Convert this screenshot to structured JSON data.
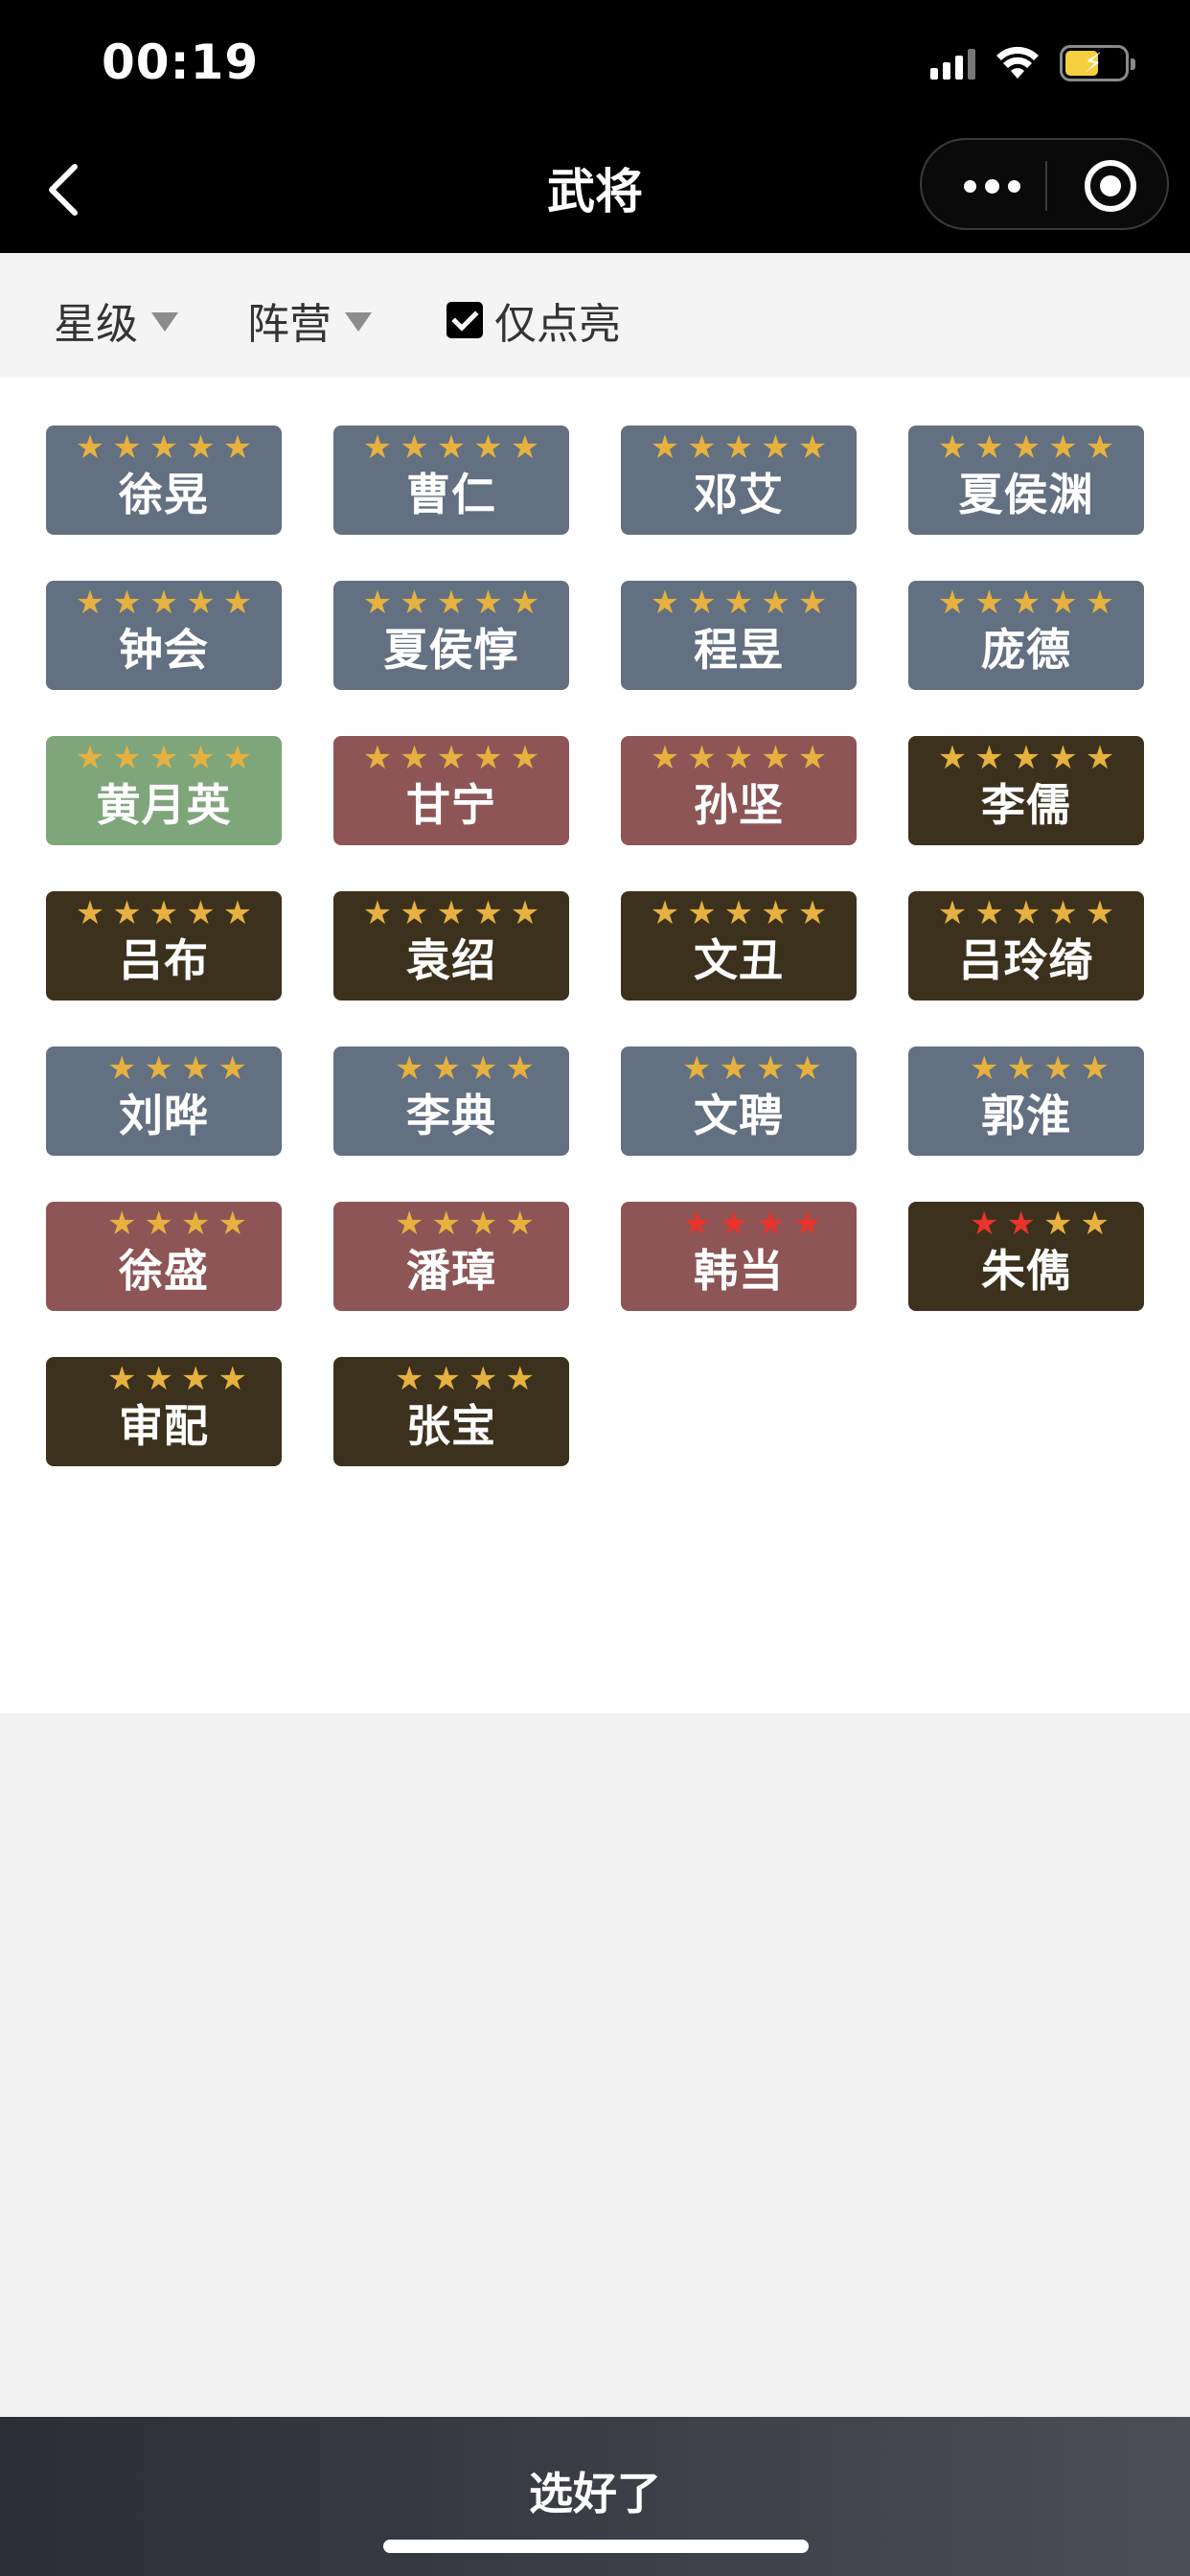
{
  "status_bar": {
    "time": "00:19"
  },
  "nav": {
    "title": "武将"
  },
  "filters": {
    "star_label": "星级",
    "faction_label": "阵营",
    "lit_only_label": "仅点亮",
    "lit_only_checked": true
  },
  "colors": {
    "blue": "#627081",
    "green": "#7fa57b",
    "red": "#8d5556",
    "dark": "#3c311d",
    "star_gold": "#e6b13f",
    "star_red": "#e8342c"
  },
  "generals": [
    {
      "name": "徐晃",
      "stars": 5,
      "red_stars": 0,
      "faction": "blue"
    },
    {
      "name": "曹仁",
      "stars": 5,
      "red_stars": 0,
      "faction": "blue"
    },
    {
      "name": "邓艾",
      "stars": 5,
      "red_stars": 0,
      "faction": "blue"
    },
    {
      "name": "夏侯渊",
      "stars": 5,
      "red_stars": 0,
      "faction": "blue"
    },
    {
      "name": "钟会",
      "stars": 5,
      "red_stars": 0,
      "faction": "blue"
    },
    {
      "name": "夏侯惇",
      "stars": 5,
      "red_stars": 0,
      "faction": "blue"
    },
    {
      "name": "程昱",
      "stars": 5,
      "red_stars": 0,
      "faction": "blue"
    },
    {
      "name": "庞德",
      "stars": 5,
      "red_stars": 0,
      "faction": "blue"
    },
    {
      "name": "黄月英",
      "stars": 5,
      "red_stars": 0,
      "faction": "green"
    },
    {
      "name": "甘宁",
      "stars": 5,
      "red_stars": 0,
      "faction": "red"
    },
    {
      "name": "孙坚",
      "stars": 5,
      "red_stars": 0,
      "faction": "red"
    },
    {
      "name": "李儒",
      "stars": 5,
      "red_stars": 0,
      "faction": "dark"
    },
    {
      "name": "吕布",
      "stars": 5,
      "red_stars": 0,
      "faction": "dark"
    },
    {
      "name": "袁绍",
      "stars": 5,
      "red_stars": 0,
      "faction": "dark"
    },
    {
      "name": "文丑",
      "stars": 5,
      "red_stars": 0,
      "faction": "dark"
    },
    {
      "name": "吕玲绮",
      "stars": 5,
      "red_stars": 0,
      "faction": "dark"
    },
    {
      "name": "刘晔",
      "stars": 4,
      "red_stars": 0,
      "faction": "blue"
    },
    {
      "name": "李典",
      "stars": 4,
      "red_stars": 0,
      "faction": "blue"
    },
    {
      "name": "文聘",
      "stars": 4,
      "red_stars": 0,
      "faction": "blue"
    },
    {
      "name": "郭淮",
      "stars": 4,
      "red_stars": 0,
      "faction": "blue"
    },
    {
      "name": "徐盛",
      "stars": 4,
      "red_stars": 0,
      "faction": "red"
    },
    {
      "name": "潘璋",
      "stars": 4,
      "red_stars": 0,
      "faction": "red"
    },
    {
      "name": "韩当",
      "stars": 4,
      "red_stars": 4,
      "faction": "red"
    },
    {
      "name": "朱儁",
      "stars": 4,
      "red_stars": 2,
      "faction": "dark"
    },
    {
      "name": "审配",
      "stars": 4,
      "red_stars": 0,
      "faction": "dark"
    },
    {
      "name": "张宝",
      "stars": 4,
      "red_stars": 0,
      "faction": "dark"
    }
  ],
  "bottom": {
    "confirm_label": "选好了"
  }
}
